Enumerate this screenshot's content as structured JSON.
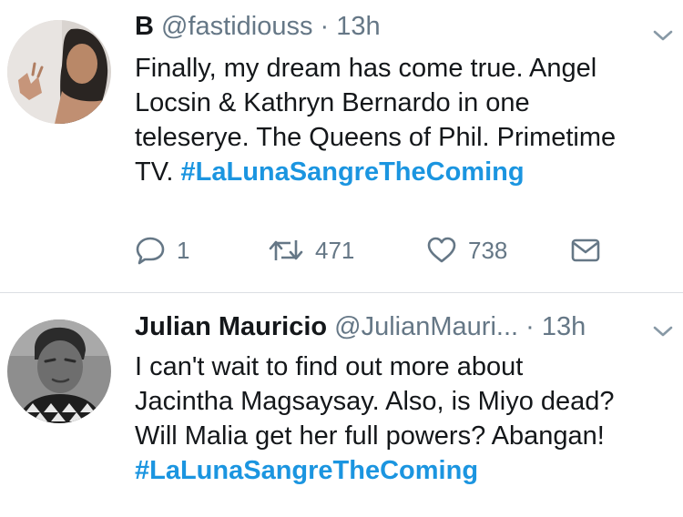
{
  "tweets": [
    {
      "name": "B",
      "handle": "@fastidiouss",
      "separator": "·",
      "time": "13h",
      "text_lines": [
        "Finally, my dream has come true. Angel",
        "Locsin & Kathryn Bernardo in one",
        "teleserye. The Queens of Phil. Primetime"
      ],
      "last_line_prefix": "TV. ",
      "hashtag": "#LaLunaSangreTheComing",
      "actions": {
        "replies": "1",
        "retweets": "471",
        "likes": "738"
      },
      "icons": {
        "reply": "reply-icon",
        "retweet": "retweet-icon",
        "like": "heart-icon",
        "dm": "envelope-icon",
        "menu": "chevron-down-icon"
      }
    },
    {
      "name": "Julian Mauricio",
      "handle": "@JulianMauri...",
      "separator": "·",
      "time": "13h",
      "text_lines": [
        "I can't wait to find out more about",
        "Jacintha Magsaysay. Also, is Miyo dead?",
        "Will Malia get her full powers? Abangan!"
      ],
      "hashtag": "#LaLunaSangreTheComing",
      "icons": {
        "menu": "chevron-down-icon"
      }
    }
  ],
  "colors": {
    "hashtag": "#1b95e0",
    "secondary_text": "#657786",
    "icon": "#657786",
    "divider": "#dcdfe3"
  }
}
